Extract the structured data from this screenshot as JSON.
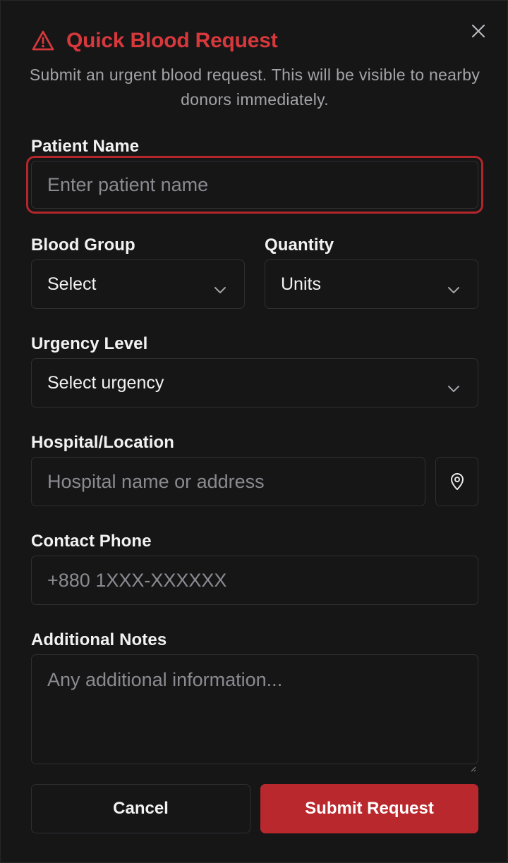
{
  "dialog": {
    "title": "Quick Blood Request",
    "subtitle": "Submit an urgent blood request. This will be visible to nearby donors immediately."
  },
  "fields": {
    "patient_name": {
      "label": "Patient Name",
      "placeholder": "Enter patient name"
    },
    "blood_group": {
      "label": "Blood Group",
      "value": "Select"
    },
    "quantity": {
      "label": "Quantity",
      "value": "Units"
    },
    "urgency": {
      "label": "Urgency Level",
      "value": "Select urgency"
    },
    "hospital": {
      "label": "Hospital/Location",
      "placeholder": "Hospital name or address"
    },
    "phone": {
      "label": "Contact Phone",
      "placeholder": "+880 1XXX-XXXXXX"
    },
    "notes": {
      "label": "Additional Notes",
      "placeholder": "Any additional information..."
    }
  },
  "buttons": {
    "cancel": "Cancel",
    "submit": "Submit Request"
  },
  "icons": {
    "close": "close-icon",
    "warning": "warning-triangle-icon",
    "chevron": "chevron-down-icon",
    "location": "map-pin-icon"
  },
  "colors": {
    "accent": "#d7383c",
    "primary_button": "#b9282c",
    "background": "#161617",
    "border": "#2f2f33"
  }
}
